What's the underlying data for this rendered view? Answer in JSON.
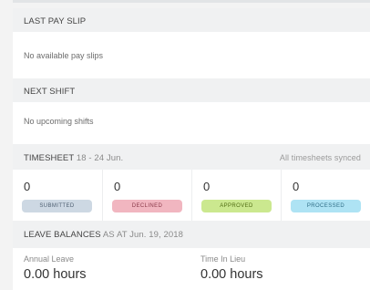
{
  "last_pay_slip": {
    "title": "LAST PAY SLIP",
    "empty_text": "No available pay slips"
  },
  "next_shift": {
    "title": "NEXT SHIFT",
    "empty_text": "No upcoming shifts"
  },
  "timesheet": {
    "title": "TIMESHEET",
    "date_range": "18 - 24 Jun.",
    "sync_status": "All timesheets synced",
    "cards": [
      {
        "count": "0",
        "label": "SUBMITTED",
        "color": "#cdd8e3"
      },
      {
        "count": "0",
        "label": "DECLINED",
        "color": "#f1b6c0"
      },
      {
        "count": "0",
        "label": "APPROVED",
        "color": "#cbe88f"
      },
      {
        "count": "0",
        "label": "PROCESSED",
        "color": "#aee3f4"
      }
    ]
  },
  "leave_balances": {
    "title": "LEAVE BALANCES",
    "as_at": "AS AT Jun. 19, 2018",
    "items": [
      {
        "label": "Annual Leave",
        "value": "0.00 hours"
      },
      {
        "label": "Time In Lieu",
        "value": "0.00 hours"
      }
    ]
  }
}
